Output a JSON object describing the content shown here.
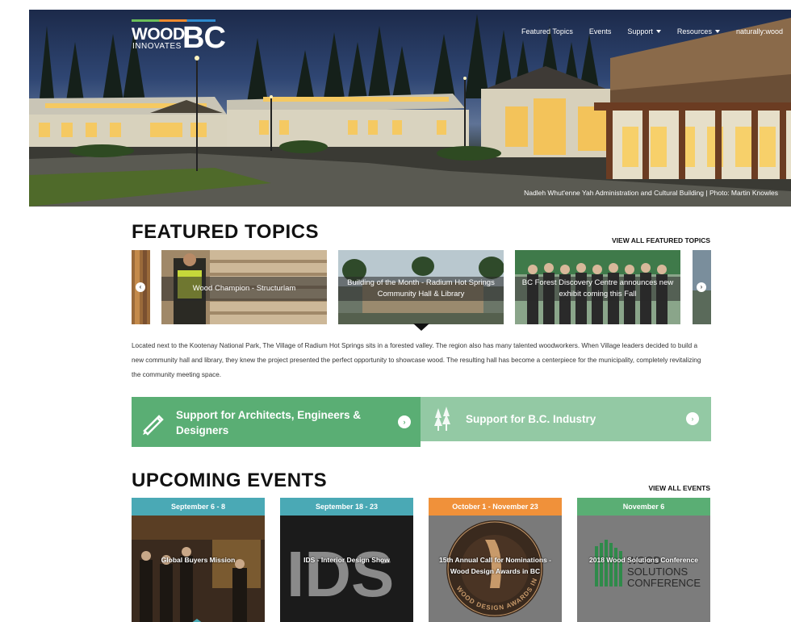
{
  "logo": {
    "wood": "WOOD",
    "innovates": "INNOVATES",
    "bc": "BC"
  },
  "nav": [
    {
      "label": "Featured Topics",
      "dropdown": false
    },
    {
      "label": "Events",
      "dropdown": false
    },
    {
      "label": "Support",
      "dropdown": true
    },
    {
      "label": "Resources",
      "dropdown": true
    },
    {
      "label": "naturally:wood",
      "dropdown": false
    }
  ],
  "hero": {
    "caption": "Nadleh Whut'enne Yah Administration and Cultural Building | Photo: Martin Knowles"
  },
  "featured": {
    "title": "FEATURED TOPICS",
    "view_all": "VIEW ALL FEATURED TOPICS",
    "slides": [
      {
        "label": "Wood Champion - Structurlam"
      },
      {
        "label": "Building of the Month - Radium Hot Springs Community Hall & Library"
      },
      {
        "label": "BC Forest Discovery Centre announces new exhibit coming this Fall"
      }
    ],
    "description": "Located next to the Kootenay National Park, The Village of Radium Hot Springs sits in a forested valley. The region also has many talented woodworkers. When Village leaders decided to build a new community hall and library, they knew the project presented the perfect opportunity to showcase wood. The resulting hall has become a centerpiece for the municipality, completely revitalizing the community meeting space."
  },
  "support": [
    {
      "label": "Support for Architects, Engineers & Designers",
      "icon": "pencil-icon",
      "color": "#5aae74"
    },
    {
      "label": "Support for B.C. Industry",
      "icon": "trees-icon",
      "color": "#93c9a4"
    }
  ],
  "events": {
    "title": "UPCOMING EVENTS",
    "view_all": "VIEW ALL EVENTS",
    "items": [
      {
        "date": "September 6 - 8",
        "title": "Global Buyers Mission",
        "color": "#4aa9b5"
      },
      {
        "date": "September 18 - 23",
        "title": "IDS - Interior Design Show",
        "color": "#4aa9b5"
      },
      {
        "date": "October 1 - November 23",
        "title": "15th Annual Call for Nominations - Wood Design Awards in BC",
        "color": "#f0913a"
      },
      {
        "date": "November 6",
        "title": "2018 Wood Solutions Conference",
        "color": "#5aae74"
      }
    ],
    "ids_logo": "IDS",
    "wood_awards_ring": "WOOD DESIGN AWARDS IN BC",
    "ws_logo": [
      "WOOD",
      "SOLUTIONS",
      "CONFERENCE"
    ]
  }
}
